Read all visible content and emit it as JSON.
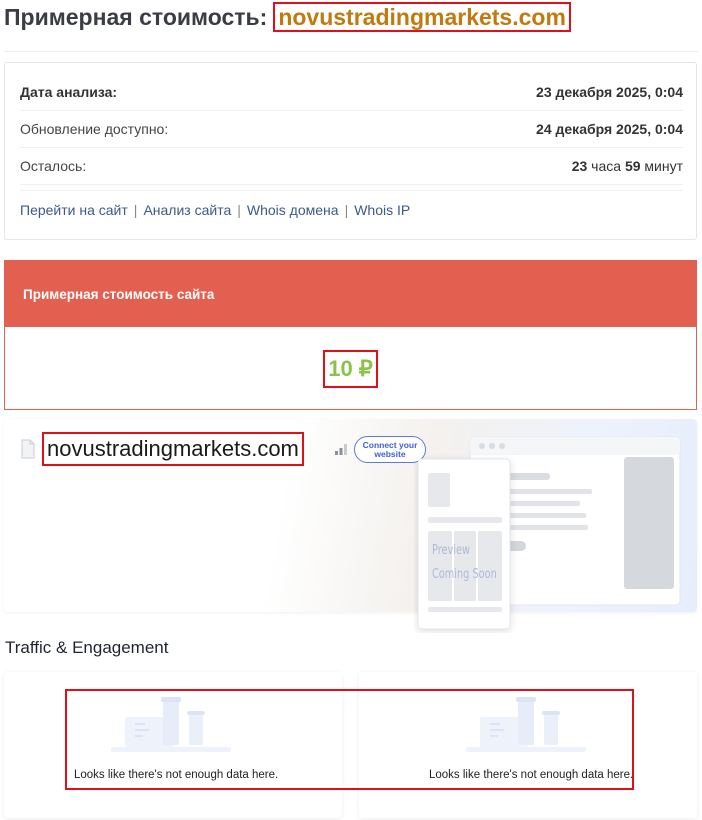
{
  "header": {
    "title_prefix": "Примерная стоимость:",
    "domain": "novustradingmarkets.com"
  },
  "info": {
    "rows": [
      {
        "label": "Дата анализа:",
        "value": "23 декабря 2025, 0:04"
      },
      {
        "label": "Обновление доступно:",
        "value": "24 декабря 2025, 0:04"
      },
      {
        "label": "Осталось:",
        "hours_num": "23",
        "hours_unit": "часа",
        "minutes_num": "59",
        "minutes_unit": "минут"
      }
    ],
    "links": [
      "Перейти на сайт",
      "Анализ сайта",
      "Whois домена",
      "Whois IP"
    ],
    "link_separator": "|"
  },
  "estimate": {
    "header": "Примерная стоимость сайта",
    "price": "10 ₽"
  },
  "preview": {
    "domain": "novustradingmarkets.com",
    "connect_button": "Connect your website",
    "preview_text_line1": "Preview",
    "preview_text_line2": "Coming Soon",
    "icons": [
      "file-icon",
      "signal-bars-icon"
    ]
  },
  "traffic": {
    "title": "Traffic & Engagement",
    "cards": [
      {
        "message": "Looks like there's not enough data here."
      },
      {
        "message": "Looks like there's not enough data here."
      }
    ]
  },
  "colors": {
    "accent_red": "#e36050",
    "price_green": "#8bc34a",
    "domain_orange": "#c27a0e",
    "link_blue": "#3b5a8a",
    "highlight_red": "#e0101a"
  }
}
